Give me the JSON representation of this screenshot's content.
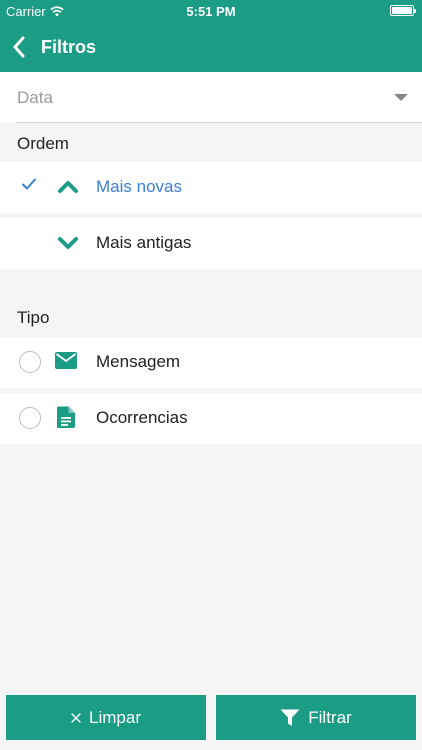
{
  "status_bar": {
    "carrier": "Carrier",
    "time": "5:51 PM"
  },
  "navbar": {
    "title": "Filtros",
    "back_icon": "chevron-left-icon"
  },
  "date_dropdown": {
    "value": "Data"
  },
  "ordem": {
    "label": "Ordem",
    "items": [
      {
        "label": "Mais novas",
        "selected": true,
        "icon": "chevron-up-icon"
      },
      {
        "label": "Mais antigas",
        "selected": false,
        "icon": "chevron-down-icon"
      }
    ]
  },
  "tipo": {
    "label": "Tipo",
    "items": [
      {
        "label": "Mensagem",
        "checked": false,
        "icon": "envelope-icon"
      },
      {
        "label": "Ocorrencias",
        "checked": false,
        "icon": "document-icon"
      }
    ]
  },
  "actions": {
    "clear_label": "Limpar",
    "filter_label": "Filtrar"
  },
  "colors": {
    "primary": "#1a9c85",
    "selected_text": "#3b7fd4",
    "background": "#f5f5f5"
  }
}
